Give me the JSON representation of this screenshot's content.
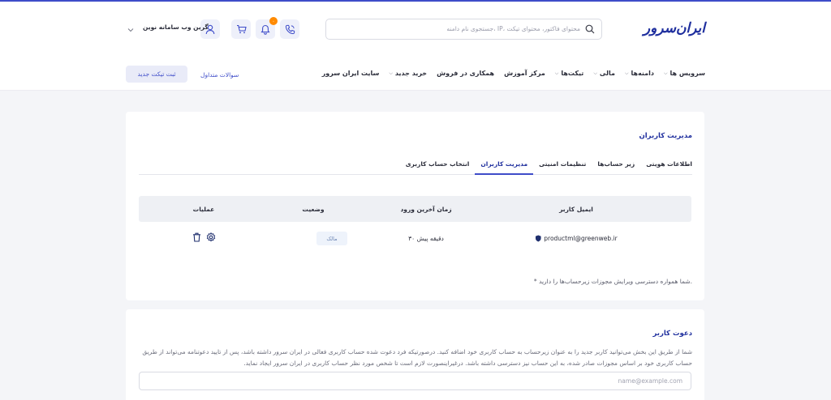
{
  "header": {
    "logo_text": "ایران‌سرور",
    "search_placeholder": "جستجوی نام دامنه، IP، محتوای فاکتور، محتوای تیکت",
    "notification_count": "۰",
    "user_name": "گرین وب سامانه نوین"
  },
  "nav": {
    "items": [
      {
        "label": "سرویس ها",
        "has_dropdown": true
      },
      {
        "label": "دامنه‌ها",
        "has_dropdown": true
      },
      {
        "label": "مالی",
        "has_dropdown": true
      },
      {
        "label": "تیکت‌ها",
        "has_dropdown": true
      },
      {
        "label": "مرکز آموزش",
        "has_dropdown": false
      },
      {
        "label": "همکاری در فروش",
        "has_dropdown": false
      },
      {
        "label": "خرید جدید",
        "has_dropdown": true
      },
      {
        "label": "سایت ایران سرور",
        "has_dropdown": false
      }
    ],
    "faq_label": "سوالات متداول",
    "new_ticket_label": "ثبت تیکت جدید"
  },
  "users_card": {
    "title": "مدیریت کاربران",
    "tabs": [
      {
        "label": "اطلاعات هویتی",
        "active": false
      },
      {
        "label": "زیر حساب‌ها",
        "active": false
      },
      {
        "label": "تنظیمات امنیتی",
        "active": false
      },
      {
        "label": "مدیریت کاربران",
        "active": true
      },
      {
        "label": "انتخاب حساب کاربری",
        "active": false
      }
    ],
    "columns": {
      "email": "ایمیل کاربر",
      "last_login": "زمان آخرین ورود",
      "status": "وضعیت",
      "operations": "عملیات"
    },
    "rows": [
      {
        "email": "productml@greenweb.ir",
        "last_login": "۳۰ دقیقه پیش",
        "status": "مالک"
      }
    ],
    "note": "* شما همواره دسترسی ویرایش مجوزات زیرحساب‌ها را دارید."
  },
  "invite_card": {
    "title": "دعوت کاربر",
    "description": "شما از طریق این بخش می‌توانید کاربر جدید را به عنوان زیرحساب به حساب کاربری خود اضافه کنید. درصورتیکه فرد دعوت شده حساب کاربری فعالی در ایران سرور داشته باشد، پس از تایید دعوتنامه می‌تواند از طریق حساب کاربری خود بر اساس مجوزات صادر شده، به این حساب نیز دسترسی داشته باشد. درغیراینصورت لازم است تا شخص مورد نظر حساب کاربری در ایران سرور ایجاد نماید.",
    "email_placeholder": "name@example.com"
  },
  "colors": {
    "accent": "#3e4cc9",
    "brand": "#1f2f9e",
    "badge": "#ff8a00"
  }
}
